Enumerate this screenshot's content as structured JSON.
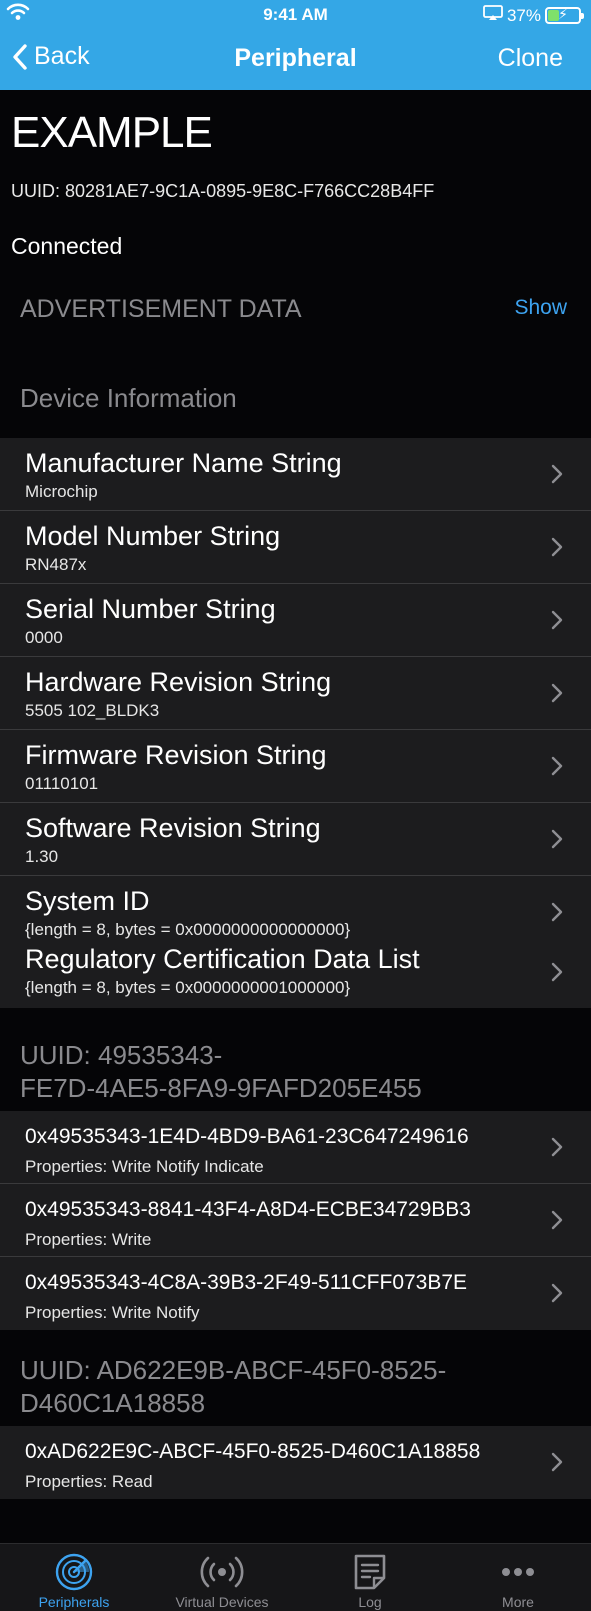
{
  "status": {
    "time": "9:41 AM",
    "battery": "37%",
    "battery_level": 0.37
  },
  "nav": {
    "back_label": "Back",
    "title": "Peripheral",
    "clone_label": "Clone"
  },
  "device": {
    "name": "EXAMPLE",
    "uuid": "UUID: 80281AE7-9C1A-0895-9E8C-F766CC28B4FF",
    "state": "Connected"
  },
  "advertisement": {
    "title": "ADVERTISEMENT DATA",
    "show_label": "Show"
  },
  "sections": [
    {
      "title": "Device Information",
      "rows": [
        {
          "name": "Manufacturer Name String",
          "value": "Microchip"
        },
        {
          "name": "Model Number String",
          "value": "RN487x"
        },
        {
          "name": "Serial Number String",
          "value": "0000"
        },
        {
          "name": "Hardware Revision String",
          "value": "5505 102_BLDK3"
        },
        {
          "name": "Firmware Revision String",
          "value": "01110101"
        },
        {
          "name": "Software Revision String",
          "value": "1.30"
        },
        {
          "name": "System ID",
          "value": "{length = 8, bytes = 0x0000000000000000}"
        },
        {
          "name": "Regulatory Certification Data List",
          "value": "{length = 8, bytes = 0x0000000001000000}"
        }
      ]
    },
    {
      "title_line1": "UUID: 49535343-",
      "title_line2": "FE7D-4AE5-8FA9-9FAFD205E455",
      "rows": [
        {
          "name": "0x49535343-1E4D-4BD9-BA61-23C647249616",
          "value": "Properties: Write Notify Indicate"
        },
        {
          "name": "0x49535343-8841-43F4-A8D4-ECBE34729BB3",
          "value": "Properties: Write"
        },
        {
          "name": "0x49535343-4C8A-39B3-2F49-511CFF073B7E",
          "value": "Properties: Write Notify"
        }
      ]
    },
    {
      "title_line1": "UUID: AD622E9B-ABCF-45F0-8525-",
      "title_line2": "D460C1A18858",
      "rows": [
        {
          "name": "0xAD622E9C-ABCF-45F0-8525-D460C1A18858",
          "value": "Properties: Read"
        }
      ]
    }
  ],
  "tabs": [
    {
      "label": "Peripherals",
      "icon": "radar-icon",
      "active": true
    },
    {
      "label": "Virtual Devices",
      "icon": "broadcast-icon",
      "active": false
    },
    {
      "label": "Log",
      "icon": "document-icon",
      "active": false
    },
    {
      "label": "More",
      "icon": "ellipsis-icon",
      "active": false
    }
  ],
  "colors": {
    "accent": "#34a7e6",
    "link": "#3da3f0",
    "background": "#050507",
    "cell": "#1c1c1e"
  }
}
